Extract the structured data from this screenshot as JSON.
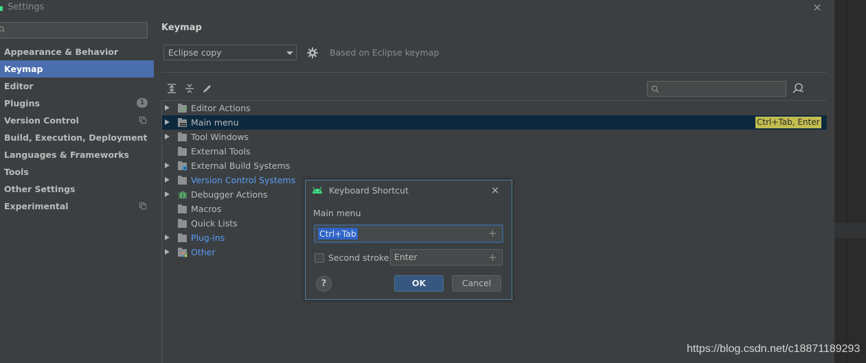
{
  "window": {
    "title": "Settings",
    "close_label": "×"
  },
  "sidebar": {
    "search_placeholder": "",
    "items": [
      {
        "label": "Appearance & Behavior"
      },
      {
        "label": "Keymap",
        "selected": true
      },
      {
        "label": "Editor"
      },
      {
        "label": "Plugins",
        "badge": "1"
      },
      {
        "label": "Version Control",
        "icon": "copy-icon"
      },
      {
        "label": "Build, Execution, Deployment"
      },
      {
        "label": "Languages & Frameworks"
      },
      {
        "label": "Tools"
      },
      {
        "label": "Other Settings"
      },
      {
        "label": "Experimental",
        "icon": "copy-icon"
      }
    ]
  },
  "keymap": {
    "title": "Keymap",
    "scheme": "Eclipse copy",
    "based_on": "Based on Eclipse keymap",
    "filter_placeholder": "",
    "toolbar": [
      "expand-all-icon",
      "collapse-all-icon",
      "edit-icon"
    ],
    "tree": [
      {
        "label": "Editor Actions",
        "expandable": true,
        "icon": "editor-actions-icon"
      },
      {
        "label": "Main menu",
        "expandable": true,
        "icon": "main-menu-icon",
        "shortcut": "Ctrl+Tab, Enter",
        "selected": true
      },
      {
        "label": "Tool Windows",
        "expandable": true,
        "icon": "folder-icon"
      },
      {
        "label": "External Tools",
        "expandable": false,
        "icon": "folder-icon"
      },
      {
        "label": "External Build Systems",
        "expandable": true,
        "icon": "build-systems-icon"
      },
      {
        "label": "Version Control Systems",
        "expandable": true,
        "icon": "folder-icon",
        "link": true
      },
      {
        "label": "Debugger Actions",
        "expandable": true,
        "icon": "bug-icon"
      },
      {
        "label": "Macros",
        "expandable": false,
        "icon": "folder-icon"
      },
      {
        "label": "Quick Lists",
        "expandable": false,
        "icon": "folder-icon"
      },
      {
        "label": "Plug-ins",
        "expandable": true,
        "icon": "folder-icon",
        "link": true
      },
      {
        "label": "Other",
        "expandable": true,
        "icon": "other-icon",
        "link": true
      }
    ]
  },
  "dialog": {
    "title": "Keyboard Shortcut",
    "action": "Main menu",
    "first_stroke": "Ctrl+Tab",
    "second_stroke_label": "Second stroke:",
    "second_stroke_checked": false,
    "second_stroke": "Enter",
    "help_label": "?",
    "ok_label": "OK",
    "cancel_label": "Cancel",
    "plus_label": "+"
  },
  "watermark": "https://blog.csdn.net/c18871189293",
  "colors": {
    "background": "#3c3f41",
    "selection": "#4b6eaf",
    "tree_selection": "#0d293e",
    "link": "#589df6",
    "shortcut_highlight": "#c2bd4f",
    "primary_button": "#365880",
    "android_green": "#3ddc84"
  }
}
